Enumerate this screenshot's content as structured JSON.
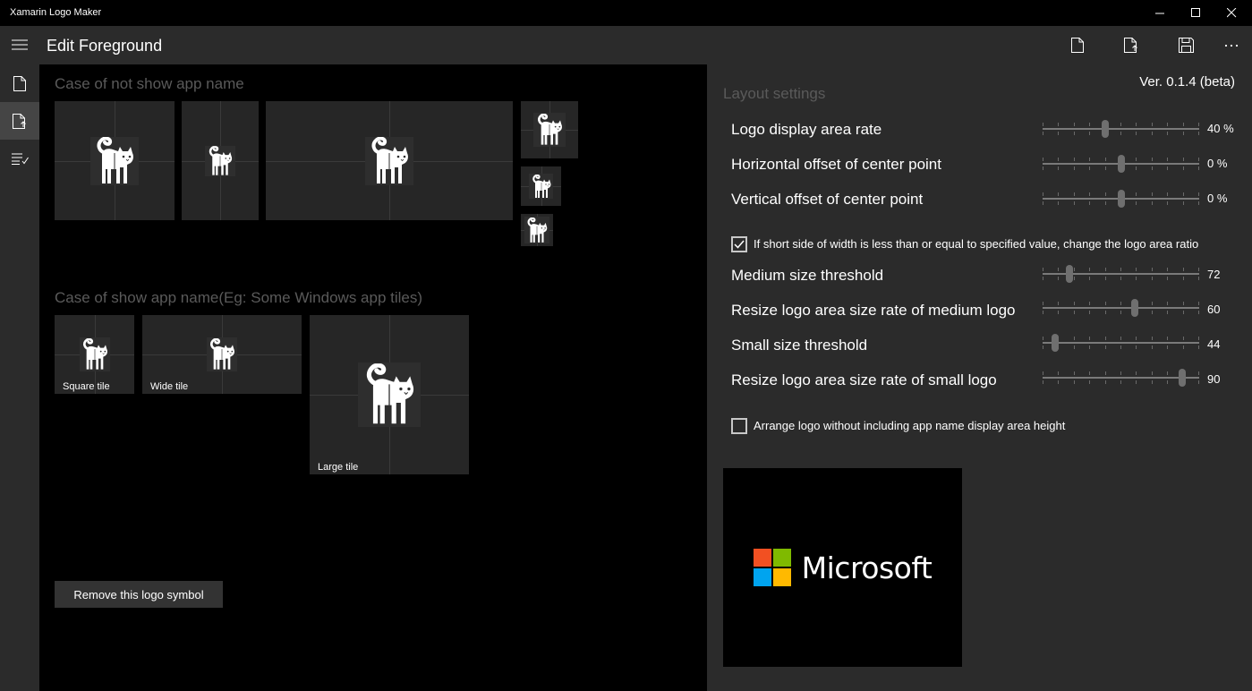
{
  "window": {
    "title": "Xamarin Logo Maker"
  },
  "header": {
    "title": "Edit Foreground"
  },
  "nav": {
    "items": [
      "new-file",
      "edit-foreground",
      "edit-list"
    ]
  },
  "main": {
    "section1_title": "Case of not show app name",
    "section2_title": "Case of show app name(Eg: Some Windows app tiles)",
    "tiles": {
      "square_label": "Square tile",
      "wide_label": "Wide tile",
      "large_label": "Large tile"
    },
    "remove_button": "Remove this logo symbol"
  },
  "settings": {
    "version": "Ver. 0.1.4 (beta)",
    "title": "Layout settings",
    "logo_rate": {
      "label": "Logo display area rate",
      "value": "40 %",
      "fraction": 0.4
    },
    "h_offset": {
      "label": "Horizontal offset of center point",
      "value": "0 %",
      "fraction": 0.5
    },
    "v_offset": {
      "label": "Vertical offset of center point",
      "value": "0 %",
      "fraction": 0.5
    },
    "change_ratio_check": {
      "label": "If short side of width is less than or equal to specified value, change the logo area ratio",
      "checked": true
    },
    "medium_threshold": {
      "label": "Medium size threshold",
      "value": "72",
      "fraction": 0.17
    },
    "medium_rate": {
      "label": "Resize logo area size rate of medium logo",
      "value": "60",
      "fraction": 0.59
    },
    "small_threshold": {
      "label": "Small size threshold",
      "value": "44",
      "fraction": 0.08
    },
    "small_rate": {
      "label": "Resize logo area size rate of small logo",
      "value": "90",
      "fraction": 0.89
    },
    "arrange_check": {
      "label": "Arrange logo without including app name display area height",
      "checked": false
    },
    "preview_text": "Microsoft"
  },
  "colors": {
    "ms_red": "#f25022",
    "ms_green": "#7fba00",
    "ms_blue": "#00a4ef",
    "ms_yellow": "#ffb900"
  }
}
